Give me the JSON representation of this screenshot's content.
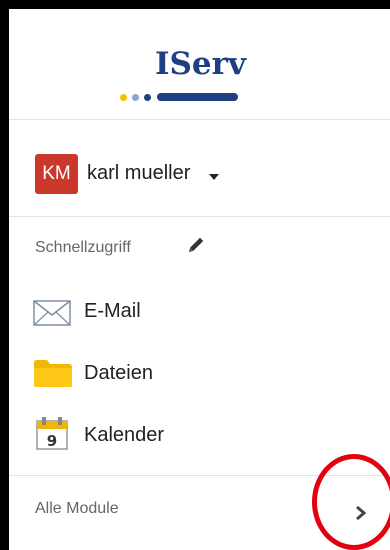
{
  "brand": {
    "logo_text": "IServ",
    "dot_colors": [
      "#f5c300",
      "#8aa6d6",
      "#1e3f82"
    ],
    "bar_color": "#1e3f82"
  },
  "user": {
    "initials": "KM",
    "name": "karl mueller",
    "avatar_color": "#c9382a"
  },
  "quick_access": {
    "label": "Schnellzugriff",
    "edit_icon": "pencil-icon"
  },
  "nav_items": [
    {
      "label": "E-Mail",
      "icon": "envelope-icon"
    },
    {
      "label": "Dateien",
      "icon": "folder-icon"
    },
    {
      "label": "Kalender",
      "icon": "calendar-icon",
      "icon_day": "9"
    }
  ],
  "modules": {
    "label": "Alle Module",
    "icon": "chevron-right-icon"
  },
  "annotation": {
    "highlight_color": "#e3000f"
  }
}
